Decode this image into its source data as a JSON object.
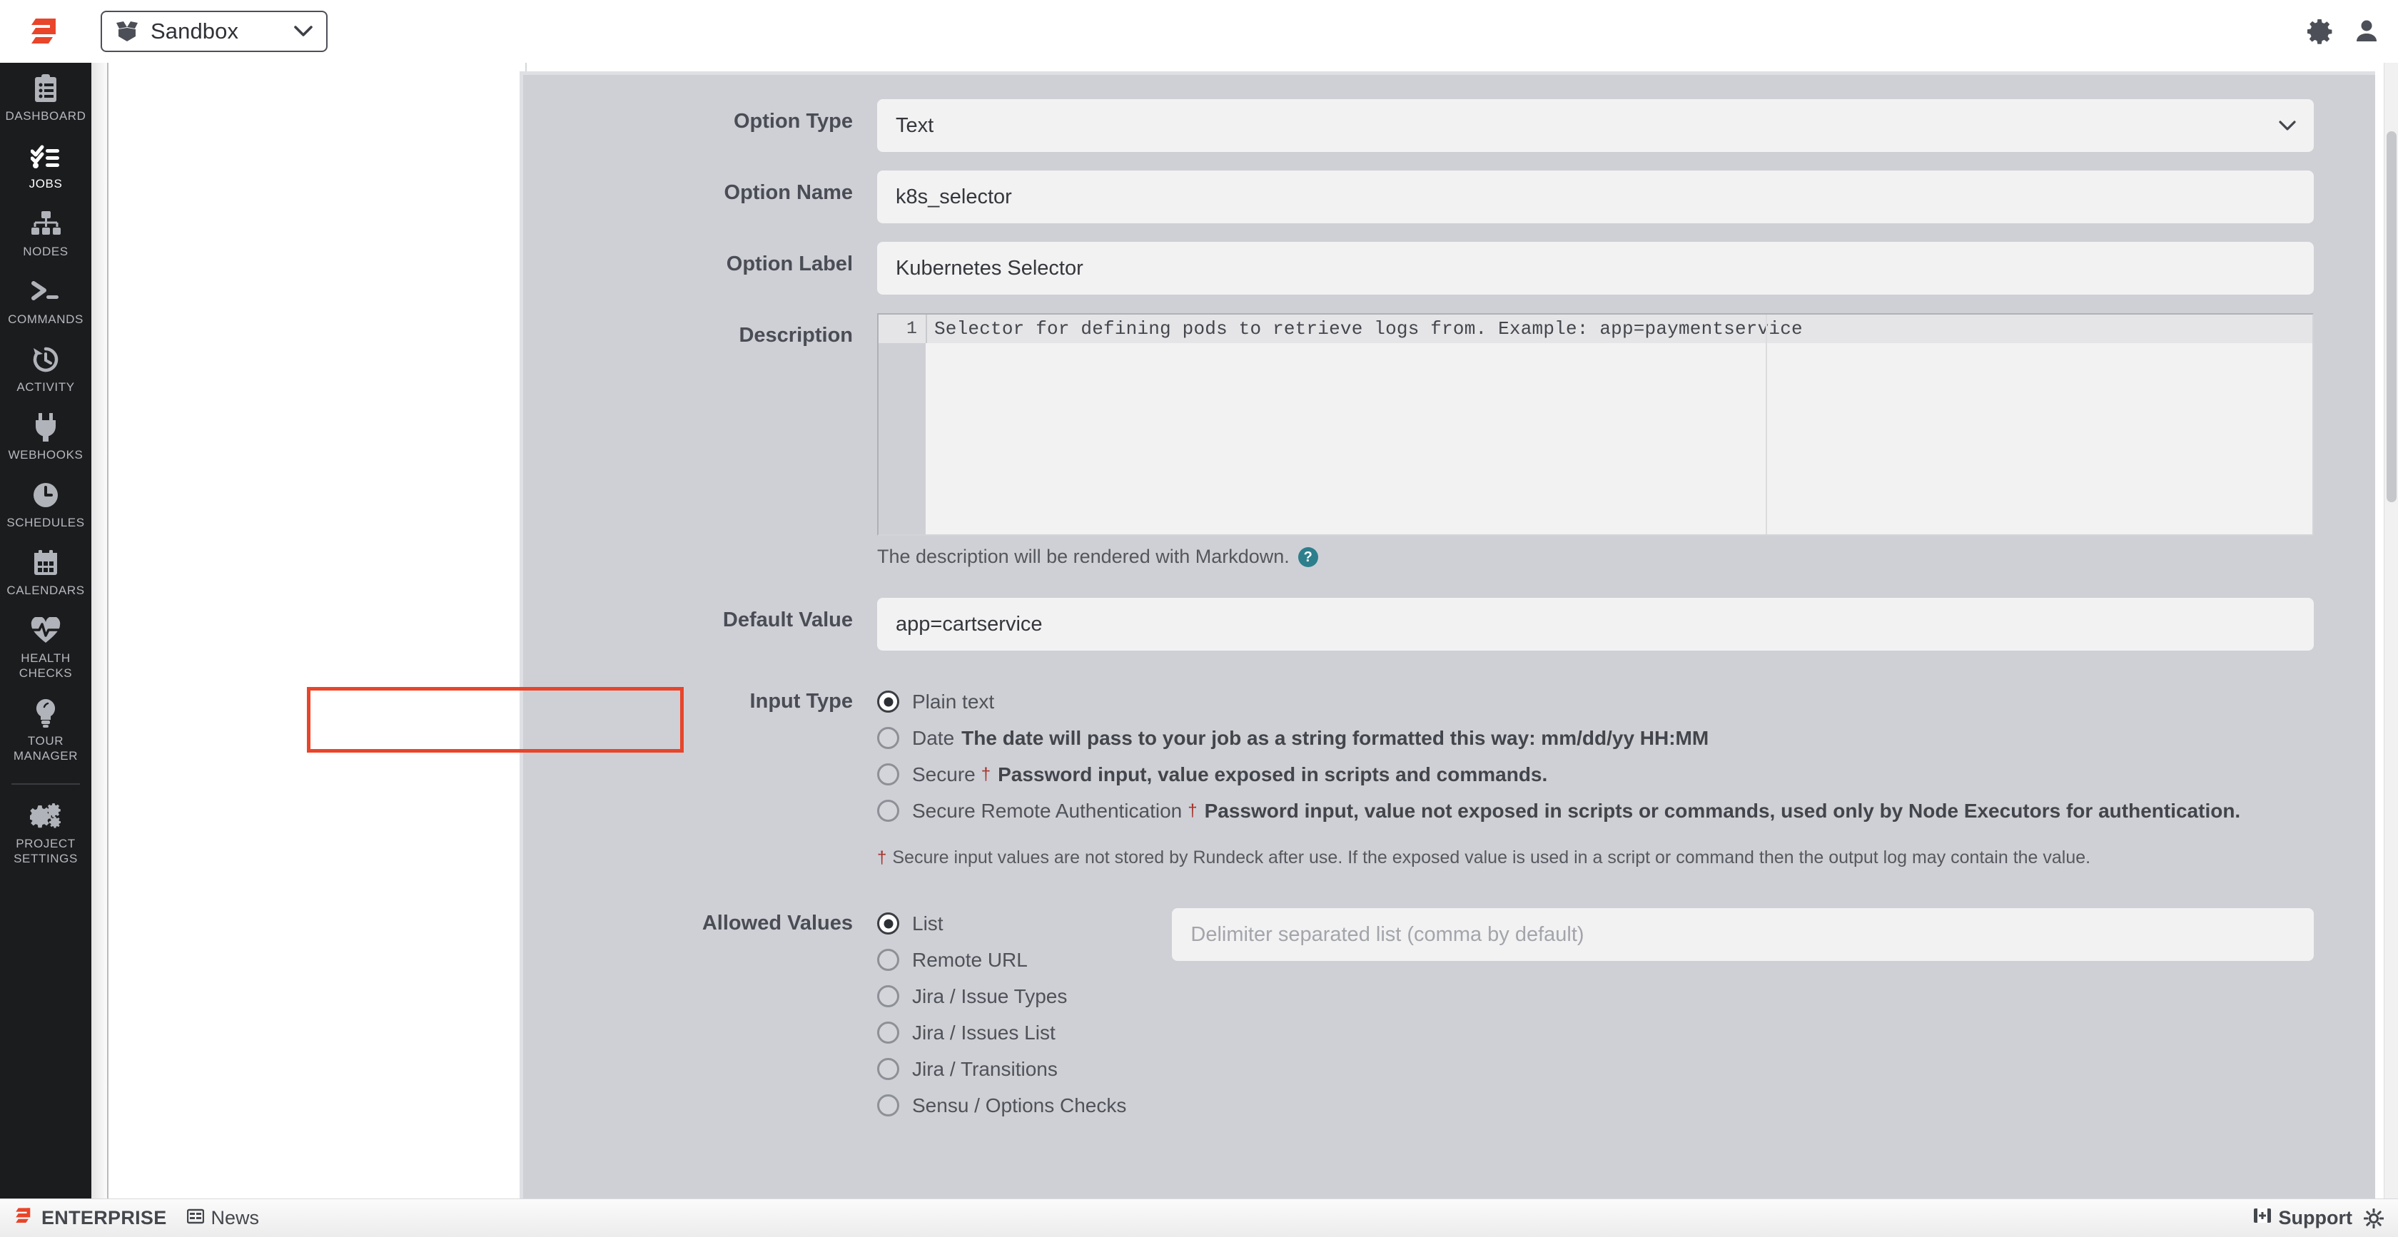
{
  "topbar": {
    "logo_icon": "rundeck-logo-icon",
    "project_selector": {
      "icon": "project-box-icon",
      "name": "Sandbox",
      "caret_icon": "chevron-down-icon"
    },
    "settings_icon": "gear-icon",
    "user_icon": "user-icon"
  },
  "sidebar": {
    "items": [
      {
        "label": "DASHBOARD",
        "icon": "clipboard-list-icon",
        "active": false
      },
      {
        "label": "JOBS",
        "icon": "checklist-icon",
        "active": true
      },
      {
        "label": "NODES",
        "icon": "sitemap-icon",
        "active": false
      },
      {
        "label": "COMMANDS",
        "icon": "terminal-prompt-icon",
        "active": false
      },
      {
        "label": "ACTIVITY",
        "icon": "history-clock-icon",
        "active": false
      },
      {
        "label": "WEBHOOKS",
        "icon": "plug-icon",
        "active": false
      },
      {
        "label": "SCHEDULES",
        "icon": "clock-icon",
        "active": false
      },
      {
        "label": "CALENDARS",
        "icon": "calendar-icon",
        "active": false
      },
      {
        "label": "HEALTH CHECKS",
        "icon": "heart-pulse-icon",
        "active": false
      },
      {
        "label": "TOUR MANAGER",
        "icon": "lightbulb-icon",
        "active": false
      },
      {
        "label": "PROJECT SETTINGS",
        "icon": "gears-icon",
        "active": false
      }
    ]
  },
  "form": {
    "option_type": {
      "label": "Option Type",
      "value": "Text",
      "caret_icon": "chevron-down-icon"
    },
    "option_name": {
      "label": "Option Name",
      "value": "k8s_selector"
    },
    "option_label": {
      "label": "Option Label",
      "value": "Kubernetes Selector"
    },
    "description": {
      "label": "Description",
      "line_number": "1",
      "value": "Selector for defining pods to retrieve logs from. Example: app=paymentservice",
      "help_text": "The description will be rendered with Markdown.",
      "help_icon": "question-circle-icon",
      "help_badge_glyph": "?"
    },
    "default_value": {
      "label": "Default Value",
      "value": "app=cartservice",
      "highlight_color": "#e8452a"
    },
    "input_type": {
      "label": "Input Type",
      "options": [
        {
          "label": "Plain text",
          "hint": "",
          "dagger": false,
          "selected": true
        },
        {
          "label": "Date",
          "hint": "The date will pass to your job as a string formatted this way: mm/dd/yy HH:MM",
          "dagger": false,
          "selected": false
        },
        {
          "label": "Secure",
          "hint": "Password input, value exposed in scripts and commands.",
          "dagger": true,
          "selected": false
        },
        {
          "label": "Secure Remote Authentication",
          "hint": "Password input, value not exposed in scripts or commands, used only by Node Executors for authentication.",
          "dagger": true,
          "selected": false
        }
      ],
      "footnote_dagger": "†",
      "footnote": "Secure input values are not stored by Rundeck after use. If the exposed value is used in a script or command then the output log may contain the value."
    },
    "allowed_values": {
      "label": "Allowed Values",
      "options": [
        {
          "label": "List",
          "selected": true
        },
        {
          "label": "Remote URL",
          "selected": false
        },
        {
          "label": "Jira / Issue Types",
          "selected": false
        },
        {
          "label": "Jira / Issues List",
          "selected": false
        },
        {
          "label": "Jira / Transitions",
          "selected": false
        },
        {
          "label": "Sensu / Options Checks",
          "selected": false
        }
      ],
      "list_placeholder": "Delimiter separated list (comma by default)"
    }
  },
  "bottombar": {
    "enterprise_label": "ENTERPRISE",
    "enterprise_icon": "rundeck-logo-icon",
    "news_label": "News",
    "news_icon": "news-grid-icon",
    "support_label": "Support",
    "support_icon": "support-book-icon",
    "settings_icon": "sun-gear-icon"
  }
}
